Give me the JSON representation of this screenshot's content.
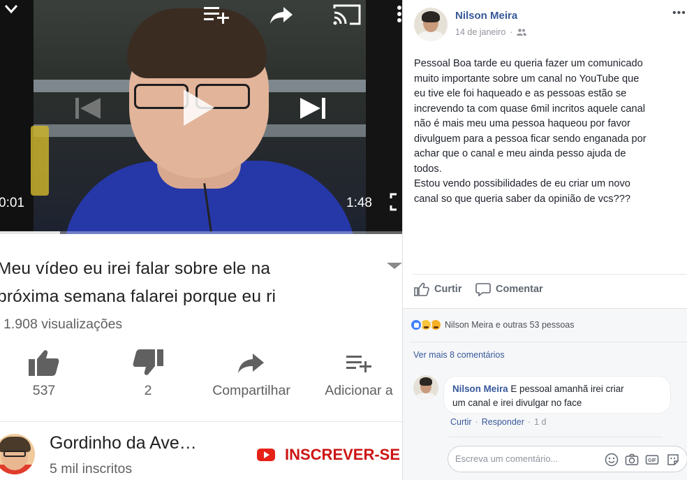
{
  "youtube": {
    "player": {
      "current_time": "0:01",
      "duration": "1:48",
      "progress_fraction": 0.15
    },
    "video_title_lines": [
      "Meu vídeo eu irei falar sobre ele na",
      "próxima semana falarei porque eu ri"
    ],
    "views": "1.908 visualizações",
    "actions": {
      "like_count": "537",
      "dislike_count": "2",
      "share_label": "Compartilhar",
      "add_label": "Adicionar a"
    },
    "channel": {
      "name": "Gordinho da Ave…",
      "subscribers": "5 mil inscritos",
      "subscribe_label": "INSCREVER-SE"
    },
    "icons": [
      "chevron-down-icon",
      "add-to-queue-icon",
      "share-icon",
      "cast-icon",
      "more-vert-icon",
      "play-icon",
      "previous-icon",
      "next-icon",
      "fullscreen-icon",
      "thumb-up-icon",
      "thumb-down-icon",
      "playlist-add-icon",
      "youtube-logo-icon"
    ],
    "colors": {
      "subscribe": "#cc1414",
      "text": "#212121",
      "secondary": "#606060"
    }
  },
  "facebook": {
    "post": {
      "author": "Nilson Meira",
      "date": "14 de janeiro",
      "privacy_icon": "friends-icon",
      "text_lines": [
        "Pessoal Boa tarde eu queria fazer um comunicado",
        "muito importante sobre um canal no YouTube que",
        "eu tive ele foi haqueado e as pessoas estão se",
        "increvendo ta com quase 6mil incritos aquele canal",
        "não é mais meu uma pessoa haqueou por favor",
        "divulguem para a pessoa ficar sendo enganada por",
        "achar que o canal e meu ainda pesso ajuda de",
        "todos.",
        "Estou vendo possibilidades de eu criar um novo",
        "canal so que queria saber da opinião de vcs???"
      ]
    },
    "actions": {
      "like": "Curtir",
      "comment": "Comentar"
    },
    "reactions_text": "Nilson Meira e outras 53 pessoas",
    "more_comments": "Ver mais 8 comentários",
    "comment": {
      "author": "Nilson Meira",
      "text_line1": "E pessoal amanhã irei criar",
      "text_line2": "um canal e irei divulgar no face",
      "like_link": "Curtir",
      "reply_link": "Responder",
      "time": "1 d"
    },
    "composer": {
      "placeholder": "Escreva um comentário..."
    },
    "colors": {
      "link": "#365899",
      "text": "#1d2129",
      "meta": "#90949c"
    }
  }
}
